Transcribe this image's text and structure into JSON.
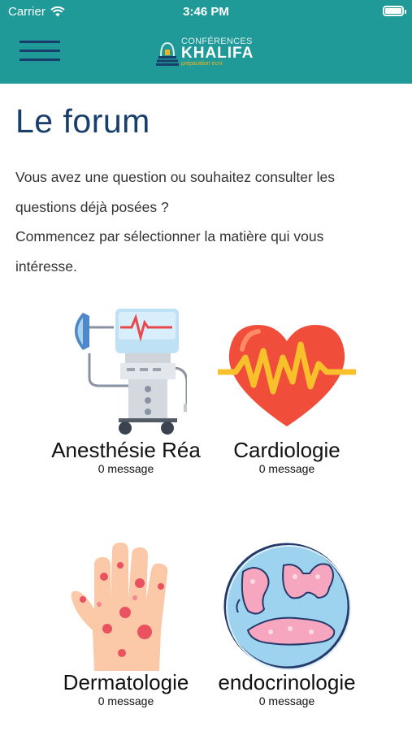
{
  "status_bar": {
    "carrier": "Carrier",
    "time": "3:46 PM"
  },
  "header": {
    "logo": {
      "line1": "CONFÉRENCES",
      "line2": "KHALIFA",
      "line3": "préparation ecni"
    }
  },
  "page": {
    "title": "Le forum",
    "intro_lines": [
      "Vous avez une question ou souhaitez consulter les",
      "questions déjà posées ?",
      "Commencez par sélectionner la matière qui vous",
      "intéresse."
    ]
  },
  "subjects": [
    {
      "name": "Anesthésie Réa",
      "count": "0 message",
      "icon": "ventilator-icon"
    },
    {
      "name": "Cardiologie",
      "count": "0 message",
      "icon": "heart-pulse-icon"
    },
    {
      "name": "Dermatologie",
      "count": "0 message",
      "icon": "rash-hand-icon"
    },
    {
      "name": "endocrinologie",
      "count": "0 message",
      "icon": "glands-icon"
    }
  ],
  "colors": {
    "header_bg": "#1f9a98",
    "title": "#183f6b",
    "logo_accent": "#f5b21b"
  }
}
